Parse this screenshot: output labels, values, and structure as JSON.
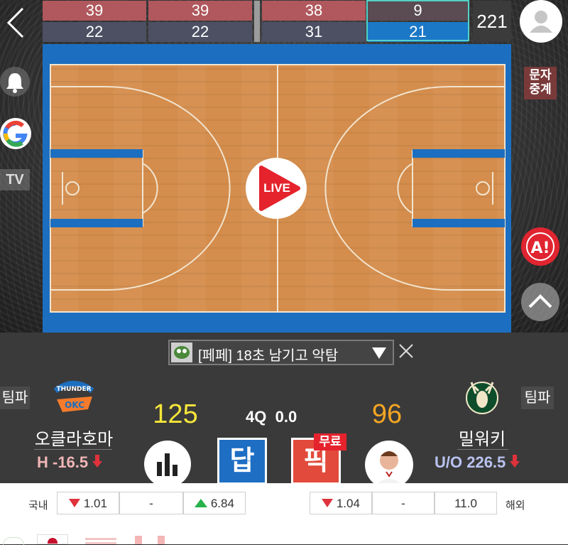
{
  "scoreboard": {
    "home_quarters": [
      "39",
      "39",
      "38",
      "9"
    ],
    "away_quarters": [
      "22",
      "22",
      "31",
      "21"
    ],
    "total": "221"
  },
  "chat_banner": "[페페] 18초 남기고 악탐",
  "side_labels": {
    "tv": "TV",
    "text_relay": "문자\n중계",
    "text_relay_top": "문자",
    "text_relay_bottom": "중계"
  },
  "live_label": "LIVE",
  "game": {
    "quarter": "4Q",
    "time": "0.0"
  },
  "home": {
    "name": "오클라호마",
    "score": "125",
    "handicap": "H -16.5",
    "team_pick": "팀파",
    "logo_text": "THUNDER",
    "logo_abbr": "OKC"
  },
  "away": {
    "name": "밀워키",
    "score": "96",
    "over_under": "U/O 226.5",
    "team_pick": "팀파"
  },
  "buttons": {
    "answer": "답",
    "pick": "픽",
    "free": "무료"
  },
  "odds": {
    "domestic_label": "국내",
    "overseas_label": "해외",
    "domestic": [
      "1.01",
      "-",
      "6.84"
    ],
    "overseas": [
      "1.04",
      "-",
      "11.0"
    ]
  },
  "colors": {
    "home_score": "#f5e63a",
    "away_score": "#f6a623",
    "handicap": "#f0b6b6",
    "over_under": "#b9c3f0",
    "down_arrow": "#e0323c",
    "up_arrow": "#27b24a"
  }
}
